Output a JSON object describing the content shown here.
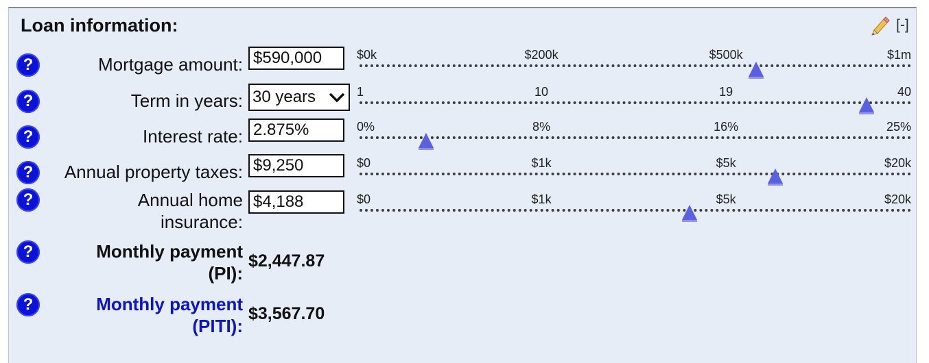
{
  "panel": {
    "title": "Loan information:",
    "edit_icon": "pencil-icon",
    "collapse_label": "[-]"
  },
  "help_label": "?",
  "rows": {
    "mortgage": {
      "label": "Mortgage amount:",
      "value": "$590,000",
      "ticks": [
        "$0k",
        "$200k",
        "$500k",
        "$1m"
      ],
      "slider_fraction": 0.72
    },
    "term": {
      "label": "Term in years:",
      "value": "30 years",
      "ticks": [
        "1",
        "10",
        "19",
        "40"
      ],
      "slider_fraction": 0.92
    },
    "rate": {
      "label": "Interest rate:",
      "value": "2.875%",
      "ticks": [
        "0%",
        "8%",
        "16%",
        "25%"
      ],
      "slider_fraction": 0.125
    },
    "taxes": {
      "label": "Annual property taxes:",
      "value": "$9,250",
      "ticks": [
        "$0",
        "$1k",
        "$5k",
        "$20k"
      ],
      "slider_fraction": 0.755
    },
    "insurance": {
      "label_line1": "Annual home",
      "label_line2": "insurance:",
      "value": "$4,188",
      "ticks": [
        "$0",
        "$1k",
        "$5k",
        "$20k"
      ],
      "slider_fraction": 0.6
    }
  },
  "results": {
    "pi": {
      "label_line1": "Monthly payment",
      "label_line2": "(PI):",
      "value": "$2,447.87"
    },
    "piti": {
      "label_line1": "Monthly payment",
      "label_line2": "(PITI):",
      "value": "$3,567.70"
    }
  },
  "colors": {
    "panel_bg": "#e6edf7",
    "help_button": "#0b14d6",
    "slider_thumb": "#5a61e0",
    "piti_label": "#0b14c8"
  }
}
